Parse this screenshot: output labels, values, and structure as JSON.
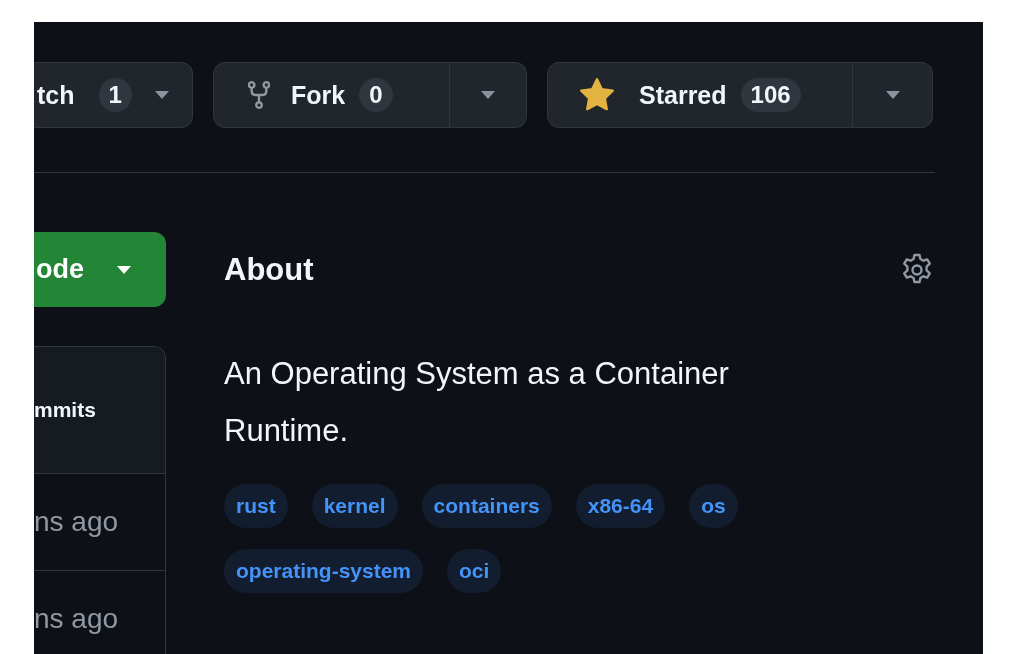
{
  "repo_actions": [
    {
      "kind": "watch",
      "label": "tch",
      "count": "1"
    },
    {
      "kind": "fork",
      "label": "Fork",
      "count": "0"
    },
    {
      "kind": "star",
      "label": "Starred",
      "count": "106",
      "starred": true
    }
  ],
  "code_button": {
    "label": "ode"
  },
  "commits": {
    "header": "mmits",
    "rows": [
      "ns ago",
      "ns ago"
    ]
  },
  "about": {
    "title": "About",
    "description": "An Operating System as a Container Runtime.",
    "topics": [
      "rust",
      "kernel",
      "containers",
      "x86-64",
      "os",
      "operating-system",
      "oci"
    ]
  }
}
